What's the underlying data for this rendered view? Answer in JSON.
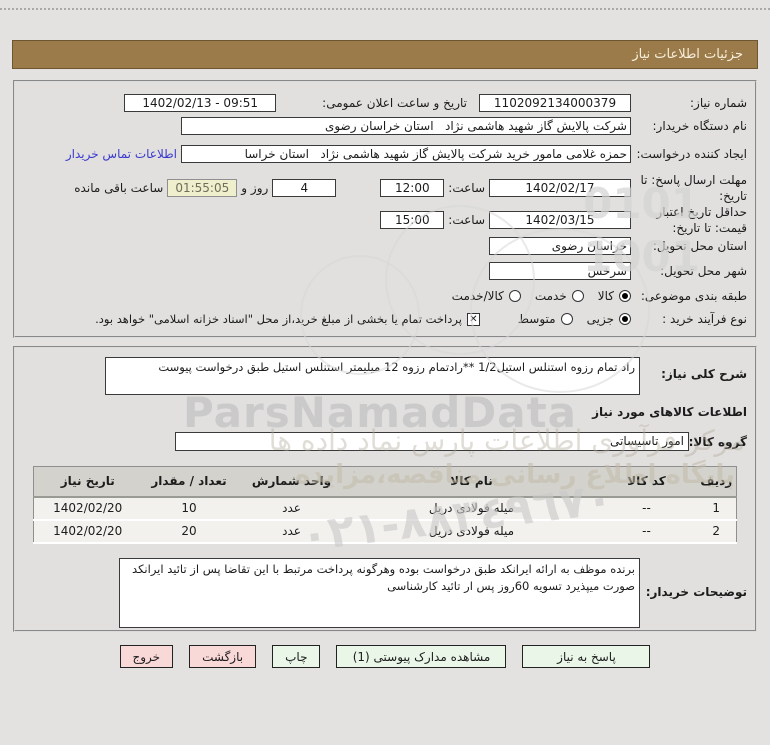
{
  "window": {
    "title": "جزئیات اطلاعات نیاز"
  },
  "fields": {
    "need_number_label": "شماره نیاز:",
    "need_number_value": "1102092134000379",
    "announce_label": "تاریخ و ساعت اعلان عمومی:",
    "announce_value": "1402/02/13 - 09:51",
    "buyer_org_label": "نام دستگاه خریدار:",
    "buyer_org_value": "شرکت پالایش گاز شهید هاشمی نژاد   استان خراسان رضوی",
    "creator_label": "ایجاد کننده درخواست:",
    "creator_value": "حمزه غلامی مامور خرید شرکت پالایش گاز شهید هاشمی نژاد   استان خراسا",
    "contact_link_label": "اطلاعات تماس خریدار",
    "deadline_label": "مهلت ارسال پاسخ: تا تاریخ:",
    "deadline_date": "1402/02/17",
    "hour_label": "ساعت:",
    "deadline_time": "12:00",
    "days_value": "4",
    "days_suffix_label": "روز و",
    "countdown_value": "01:55:05",
    "countdown_suffix_label": "ساعت باقی مانده",
    "validity_label": "حداقل تاریخ اعتبار قیمت: تا تاریخ:",
    "validity_date": "1402/03/15",
    "validity_time": "15:00",
    "province_label": "استان محل تحویل:",
    "province_value": "خراسان رضوی",
    "city_label": "شهر محل تحویل:",
    "city_value": "سرخس",
    "classification_label": "طبقه بندی موضوعی:",
    "classification_options": [
      {
        "label": "کالا",
        "selected": true
      },
      {
        "label": "خدمت",
        "selected": false
      },
      {
        "label": "کالا/خدمت",
        "selected": false
      }
    ],
    "process_label": "نوع فرآیند خرید :",
    "process_options": [
      {
        "label": "جزیی",
        "selected": true
      },
      {
        "label": "متوسط",
        "selected": false
      }
    ],
    "treasury_label": "پرداخت تمام یا بخشی از مبلغ خرید،از محل \"اسناد خزانه اسلامی\" خواهد بود.",
    "treasury_checked": true
  },
  "need_section": {
    "description_label": "شرح کلی نیاز:",
    "description_value": "راد تمام رزوه استنلس استیل1/2 **رادتمام رزوه 12 میلیمتر استنلس استیل طبق درخواست پیوست",
    "goods_info_title": "اطلاعات کالاهای مورد نیاز",
    "goods_group_label": "گروه کالا:",
    "goods_group_value": "امور تاسیساتی",
    "table": {
      "headers": [
        "ردیف",
        "کد کالا",
        "نام کالا",
        "واحد شمارش",
        "تعداد / مقدار",
        "تاریخ نیاز"
      ],
      "rows": [
        [
          "1",
          "--",
          "میله فولادی دریل",
          "عدد",
          "10",
          "1402/02/20"
        ],
        [
          "2",
          "--",
          "میله فولادی دریل",
          "عدد",
          "20",
          "1402/02/20"
        ]
      ]
    },
    "buyer_notes_label": "توضیحات خریدار:",
    "buyer_notes_value": "برنده موظف به ارائه ایرانکد طبق درخواست بوده وهرگونه پرداخت مرتبط با این تقاضا پس از تائید ایرانکد صورت میپذیرد تسویه 60روز پس ار تائید کارشناسی"
  },
  "buttons": {
    "respond": "پاسخ به نیاز",
    "view_docs": "مشاهده مدارک پیوستی (1)",
    "print": "چاپ",
    "back": "بازگشت",
    "exit": "خروج"
  },
  "watermark": {
    "brand": "ParsNamadData",
    "line_calligraphy": "مرکز فرآوری اطلاعات پارس نماد داده ها",
    "line_portal": "پایگاه اطلاع رسانی مناقصه،مزایده",
    "phone": "۰۲۱-۸۸۳٤۹٦۷۰",
    "stamp_digits_1": "0101",
    "stamp_digits_2": "1001"
  },
  "colors": {
    "title_bar": "#9c7b4b",
    "link": "#3a3ace",
    "button_green": "#eaf7e8",
    "button_pink": "#f9d8d8",
    "countdown_bg": "#efeecd"
  }
}
